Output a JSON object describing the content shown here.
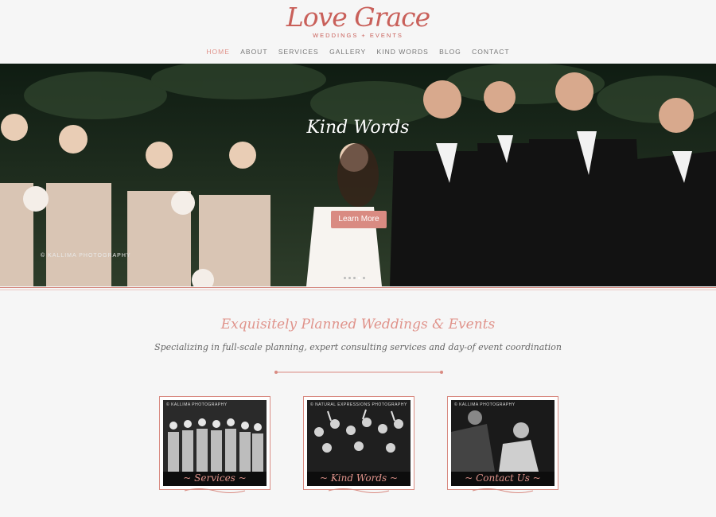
{
  "brand": {
    "name": "Love Grace",
    "tagline": "WEDDINGS + EVENTS",
    "accent": "#d98b82"
  },
  "nav": {
    "items": [
      "HOME",
      "ABOUT",
      "SERVICES",
      "GALLERY",
      "KIND WORDS",
      "BLOG",
      "CONTACT"
    ],
    "active": "HOME"
  },
  "hero": {
    "title": "Kind Words",
    "button_label": "Learn More",
    "credit": "© KALLIMA PHOTOGRAPHY",
    "slides": 5,
    "active_slide": 3
  },
  "intro": {
    "title": "Exquisitely Planned Weddings & Events",
    "subtitle": "Specializing in full-scale planning, expert consulting services and day-of event coordination"
  },
  "cards": [
    {
      "label": "~ Services ~",
      "credit": "© KALLIMA PHOTOGRAPHY"
    },
    {
      "label": "~ Kind Words ~",
      "credit": "© NATURAL EXPRESSIONS PHOTOGRAPHY"
    },
    {
      "label": "~ Contact Us ~",
      "credit": "© KALLIMA PHOTOGRAPHY"
    }
  ]
}
